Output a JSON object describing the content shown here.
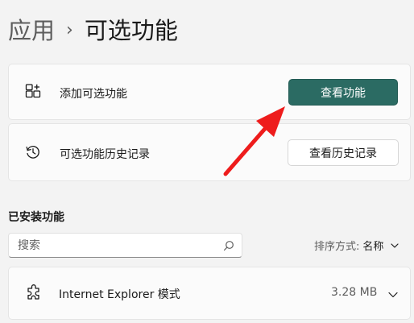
{
  "breadcrumb": {
    "parent": "应用",
    "separator": "›",
    "current": "可选功能"
  },
  "add_feature": {
    "icon": "add-apps-icon",
    "label": "添加可选功能",
    "button_label": "查看功能"
  },
  "history": {
    "icon": "history-icon",
    "label": "可选功能历史记录",
    "button_label": "查看历史记录"
  },
  "installed": {
    "title": "已安装功能",
    "search_placeholder": "搜索",
    "sort_label": "排序方式:",
    "sort_value": "名称",
    "items": [
      {
        "icon": "puzzle-piece-icon",
        "name": "Internet Explorer 模式",
        "size": "3.28 MB"
      }
    ]
  },
  "colors": {
    "primary_button": "#2b6b63",
    "annotation_arrow": "#ee1c1c"
  }
}
